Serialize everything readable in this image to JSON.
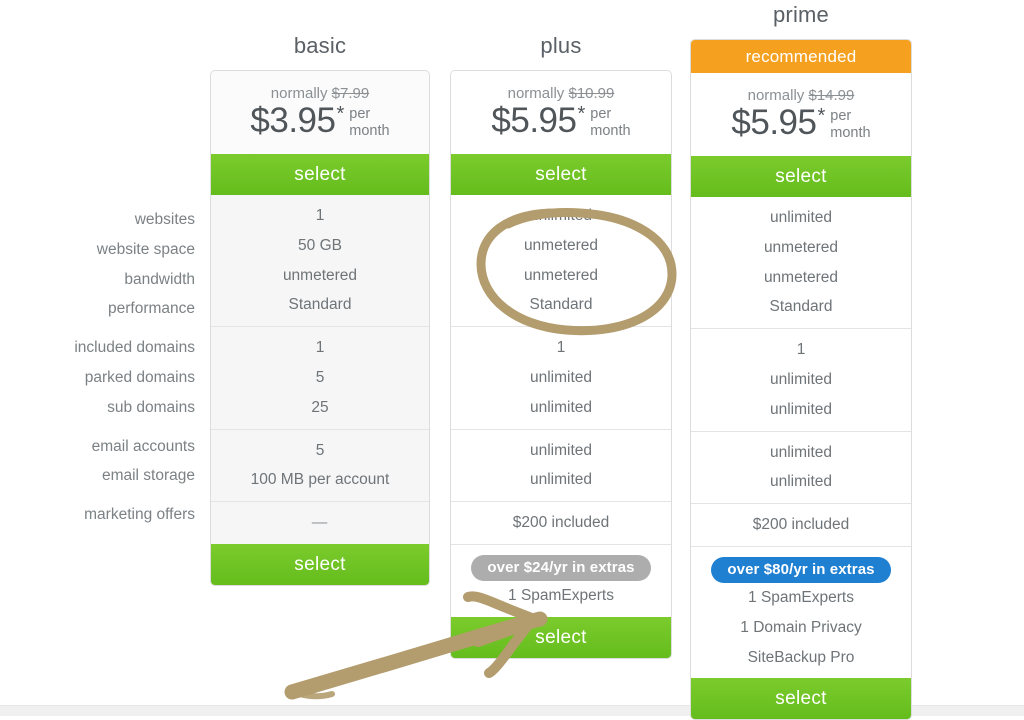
{
  "colors": {
    "select_green": "#6ec722",
    "recommended_orange": "#f5a01e",
    "extras_grey": "#adadad",
    "extras_blue": "#1f7fd1",
    "annotation_tan": "#b39c6d",
    "text_grey": "#6e7478",
    "label_grey": "#7b8185",
    "card_border": "#dcdcdc",
    "basic_card_bg": "#f6f6f6"
  },
  "feature_labels": {
    "groups": [
      [
        "websites",
        "website space",
        "bandwidth",
        "performance"
      ],
      [
        "included domains",
        "parked domains",
        "sub domains"
      ],
      [
        "email accounts",
        "email storage"
      ],
      [
        "marketing offers"
      ]
    ]
  },
  "plans": [
    {
      "name": "basic",
      "recommended_label": null,
      "normally_prefix": "normally",
      "normally_price": "$7.99",
      "price": "$3.95",
      "star": "*",
      "per": "per",
      "month": "month",
      "select_label": "select",
      "select_label_bottom": "select",
      "feature_groups": [
        [
          "1",
          "50 GB",
          "unmetered",
          "Standard"
        ],
        [
          "1",
          "5",
          "25"
        ],
        [
          "5",
          "100 MB per account"
        ],
        [
          "—"
        ]
      ],
      "extras_badge": null,
      "extras_items": []
    },
    {
      "name": "plus",
      "recommended_label": null,
      "normally_prefix": "normally",
      "normally_price": "$10.99",
      "price": "$5.95",
      "star": "*",
      "per": "per",
      "month": "month",
      "select_label": "select",
      "select_label_bottom": "select",
      "feature_groups": [
        [
          "unlimited",
          "unmetered",
          "unmetered",
          "Standard"
        ],
        [
          "1",
          "unlimited",
          "unlimited"
        ],
        [
          "unlimited",
          "unlimited"
        ],
        [
          "$200 included"
        ]
      ],
      "extras_badge": "over $24/yr in extras",
      "extras_items": [
        "1 SpamExperts"
      ]
    },
    {
      "name": "prime",
      "recommended_label": "recommended",
      "normally_prefix": "normally",
      "normally_price": "$14.99",
      "price": "$5.95",
      "star": "*",
      "per": "per",
      "month": "month",
      "select_label": "select",
      "select_label_bottom": "select",
      "feature_groups": [
        [
          "unlimited",
          "unmetered",
          "unmetered",
          "Standard"
        ],
        [
          "1",
          "unlimited",
          "unlimited"
        ],
        [
          "unlimited",
          "unlimited"
        ],
        [
          "$200 included"
        ]
      ],
      "extras_badge": "over $80/yr in extras",
      "extras_items": [
        "1 SpamExperts",
        "1 Domain Privacy",
        "SiteBackup Pro"
      ]
    }
  ],
  "annotations": {
    "circle": {
      "shape": "hand-drawn-ellipse",
      "targets": [
        "unlimited",
        "unmetered",
        "unmetered",
        "Standard"
      ],
      "plan": "plus"
    },
    "arrow": {
      "shape": "hand-drawn-arrow",
      "points_to": "plus select button",
      "direction": "up-right"
    }
  }
}
